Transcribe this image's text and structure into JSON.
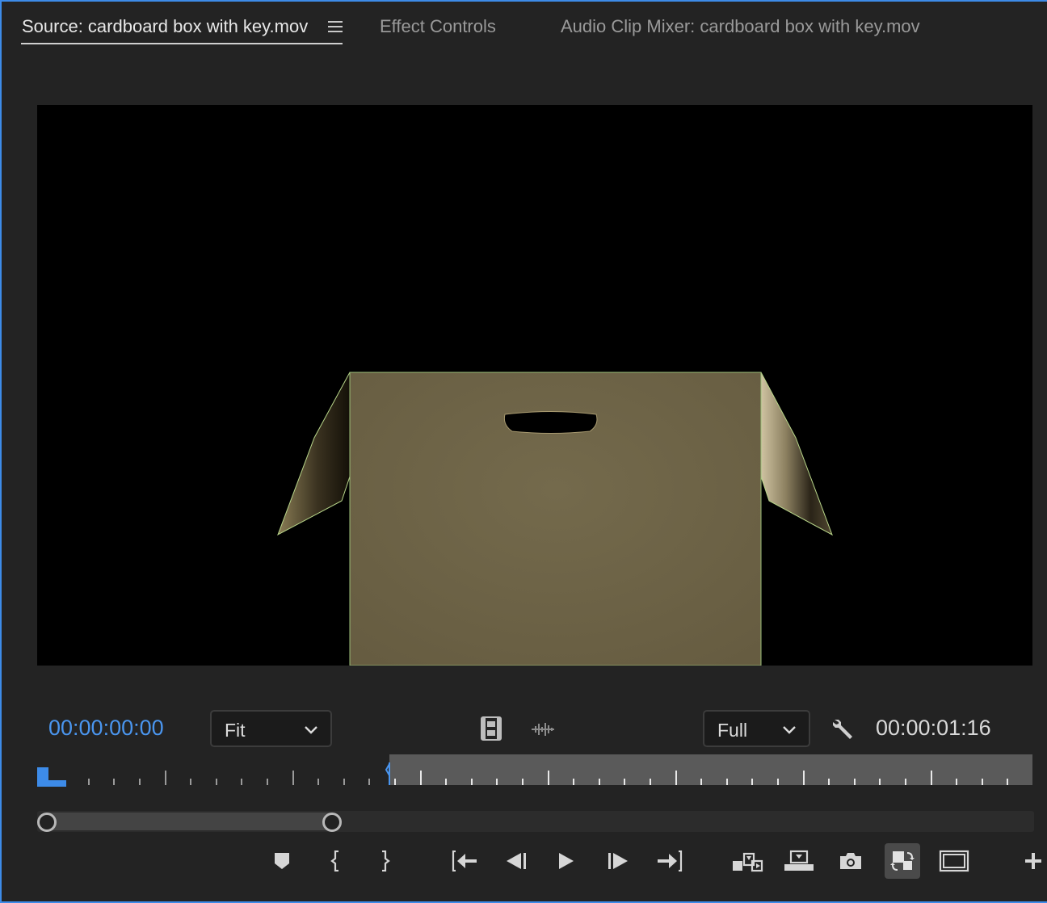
{
  "tabs": [
    {
      "label": "Source: cardboard box with key.mov",
      "active": true
    },
    {
      "label": "Effect Controls",
      "active": false
    },
    {
      "label": "Audio Clip Mixer: cardboard box with key.mov",
      "active": false
    }
  ],
  "tab_menu_icon": "hamburger-menu-icon",
  "monitor": {
    "current_timecode": "00:00:00:00",
    "duration_timecode": "00:00:01:16",
    "zoom_select": {
      "selected": "Fit"
    },
    "resolution_select": {
      "selected": "Full"
    },
    "playhead_position_fraction": 0.0
  },
  "colors": {
    "accent": "#3d8be8",
    "timecode_current": "#4a95ee",
    "panel_bg": "#232323",
    "video_bg": "#000000",
    "cardboard": "#6e6448"
  },
  "transport": [
    {
      "name": "add-marker-button",
      "icon": "marker-icon"
    },
    {
      "name": "mark-in-button",
      "icon": "mark-in-icon"
    },
    {
      "name": "mark-out-button",
      "icon": "mark-out-icon"
    },
    {
      "name": "go-to-in-button",
      "icon": "go-to-in-icon"
    },
    {
      "name": "step-back-button",
      "icon": "step-back-icon"
    },
    {
      "name": "play-button",
      "icon": "play-icon"
    },
    {
      "name": "step-forward-button",
      "icon": "step-forward-icon"
    },
    {
      "name": "go-to-out-button",
      "icon": "go-to-out-icon"
    },
    {
      "name": "insert-button",
      "icon": "insert-icon"
    },
    {
      "name": "overwrite-button",
      "icon": "overwrite-icon"
    },
    {
      "name": "export-frame-button",
      "icon": "camera-icon"
    },
    {
      "name": "toggle-proxies-button",
      "icon": "toggle-proxies-icon"
    },
    {
      "name": "safe-margins-button",
      "icon": "safe-margins-icon"
    },
    {
      "name": "add-button",
      "icon": "plus-icon"
    }
  ],
  "zoom_bar": {
    "start_fraction": 0.0,
    "end_fraction": 0.29
  }
}
